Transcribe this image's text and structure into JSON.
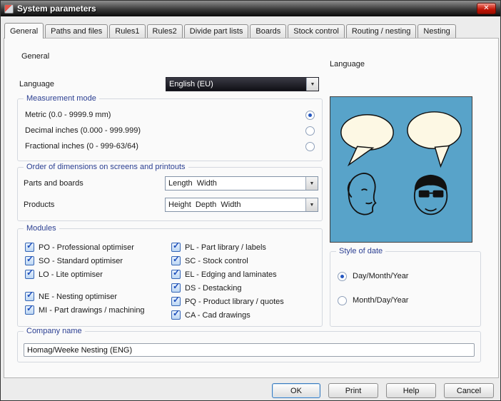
{
  "icons": {
    "dropdown_arrow": "▼",
    "check": "✓",
    "close": "✕"
  },
  "colors": {
    "titlebar_dark": "#1c1c1c",
    "close_red": "#c01405",
    "group_title_blue": "#2b3f92",
    "accent_blue": "#2456c0",
    "illustration_bg": "#58a3c9",
    "language_combo_bg": "#17171f"
  },
  "window": {
    "title": "System parameters"
  },
  "tabs": [
    {
      "label": "General",
      "active": true
    },
    {
      "label": "Paths and files"
    },
    {
      "label": "Rules1"
    },
    {
      "label": "Rules2"
    },
    {
      "label": "Divide part lists"
    },
    {
      "label": "Boards"
    },
    {
      "label": "Stock control"
    },
    {
      "label": "Routing / nesting"
    },
    {
      "label": "Nesting"
    }
  ],
  "general": {
    "section_heading": "General",
    "language_label": "Language",
    "language_value": "English (EU)",
    "measurement": {
      "title": "Measurement mode",
      "options": [
        {
          "label": "Metric (0.0 - 9999.9 mm)",
          "selected": true
        },
        {
          "label": "Decimal inches (0.000 - 999.999)",
          "selected": false
        },
        {
          "label": "Fractional inches (0 - 999-63/64)",
          "selected": false
        }
      ]
    },
    "order": {
      "title": "Order of dimensions on screens and printouts",
      "rows": [
        {
          "label": "Parts and boards",
          "value": "Length  Width"
        },
        {
          "label": "Products",
          "value": "Height  Depth  Width"
        }
      ]
    },
    "modules": {
      "title": "Modules",
      "left": [
        {
          "label": "PO - Professional optimiser",
          "checked": true
        },
        {
          "label": "SO - Standard optimiser",
          "checked": true
        },
        {
          "label": "LO - Lite optimiser",
          "checked": true
        },
        {
          "label": "NE - Nesting optimiser",
          "checked": true,
          "gap": true
        },
        {
          "label": "MI - Part drawings / machining",
          "checked": true
        }
      ],
      "right": [
        {
          "label": "PL - Part library / labels",
          "checked": true
        },
        {
          "label": "SC - Stock control",
          "checked": true
        },
        {
          "label": "EL - Edging and laminates",
          "checked": true
        },
        {
          "label": "DS - Destacking",
          "checked": true
        },
        {
          "label": "PQ - Product library / quotes",
          "checked": true
        },
        {
          "label": "CA - Cad drawings",
          "checked": true
        }
      ]
    },
    "company": {
      "title": "Company name",
      "value": "Homag/Weeke Nesting (ENG)"
    },
    "right": {
      "language_heading": "Language",
      "date_style": {
        "title": "Style of date",
        "options": [
          {
            "label": "Day/Month/Year",
            "selected": true
          },
          {
            "label": "Month/Day/Year",
            "selected": false
          }
        ]
      }
    }
  },
  "footer": {
    "ok_label": "OK",
    "print_label": "Print",
    "help_label": "Help",
    "cancel_label": "Cancel"
  }
}
